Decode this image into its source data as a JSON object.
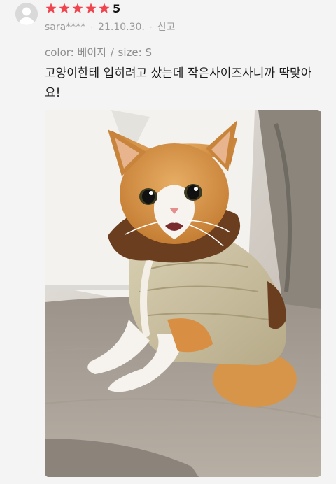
{
  "review": {
    "avatar_icon": "user-avatar-icon",
    "rating": {
      "stars": 5,
      "max_stars": 5,
      "value_text": "5",
      "star_color": "#f0454e"
    },
    "author": "sara****",
    "date": "21.10.30.",
    "report_label": "신고",
    "option": {
      "color_label": "color:",
      "color_value": "베이지",
      "separator": "/",
      "size_label": "size:",
      "size_value": "S"
    },
    "text": "고양이한테 입히려고 샀는데 작은사이즈사니까 딱맞아요!",
    "photo_icon": "review-photo-cat-in-vest"
  }
}
